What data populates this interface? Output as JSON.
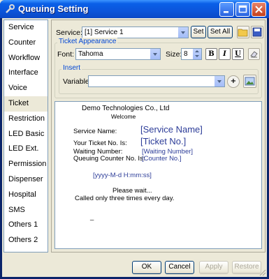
{
  "window": {
    "title": "Queuing Setting"
  },
  "sidebar": {
    "items": [
      {
        "label": "Service"
      },
      {
        "label": "Counter"
      },
      {
        "label": "Workflow"
      },
      {
        "label": "Interface"
      },
      {
        "label": "Voice"
      },
      {
        "label": "Ticket",
        "active": true
      },
      {
        "label": "Restriction"
      },
      {
        "label": "LED Basic"
      },
      {
        "label": "LED Ext."
      },
      {
        "label": "Permission"
      },
      {
        "label": "Dispenser"
      },
      {
        "label": "Hospital"
      },
      {
        "label": "SMS"
      },
      {
        "label": "Others 1"
      },
      {
        "label": "Others 2"
      }
    ]
  },
  "service_row": {
    "label": "Service:",
    "selected": "[1] Service 1",
    "set_label": "Set",
    "set_all_label": "Set All"
  },
  "appearance": {
    "title": "Ticket Appearance",
    "font_label": "Font:",
    "font_value": "Tahoma",
    "size_label": "Size:",
    "size_value": "8",
    "bold": "B",
    "italic": "I",
    "underline": "U"
  },
  "insert": {
    "title": "Insert",
    "variable_label": "Variable:",
    "variable_value": "",
    "add_label": "+"
  },
  "ticket": {
    "company": "Demo Technologies Co., Ltd",
    "welcome": "Welcome",
    "service_name_label": "Service Name:",
    "service_name_tag": "[Service Name]",
    "ticket_no_label": "Your Ticket No. Is:",
    "ticket_no_tag": "[Ticket No.]",
    "waiting_label": "Waiting Number:",
    "waiting_tag": "[Waiting Number]",
    "counter_label": "Queuing Counter No. Is:",
    "counter_tag": "[Counter No.]",
    "datetime_tag": "[yyyy-M-d H:mm:ss]",
    "please_wait": "Please wait...",
    "called_note": "Called only three times every day.",
    "cursor": "_"
  },
  "footer": {
    "ok": "OK",
    "cancel": "Cancel",
    "apply": "Apply",
    "restore": "Restore"
  }
}
